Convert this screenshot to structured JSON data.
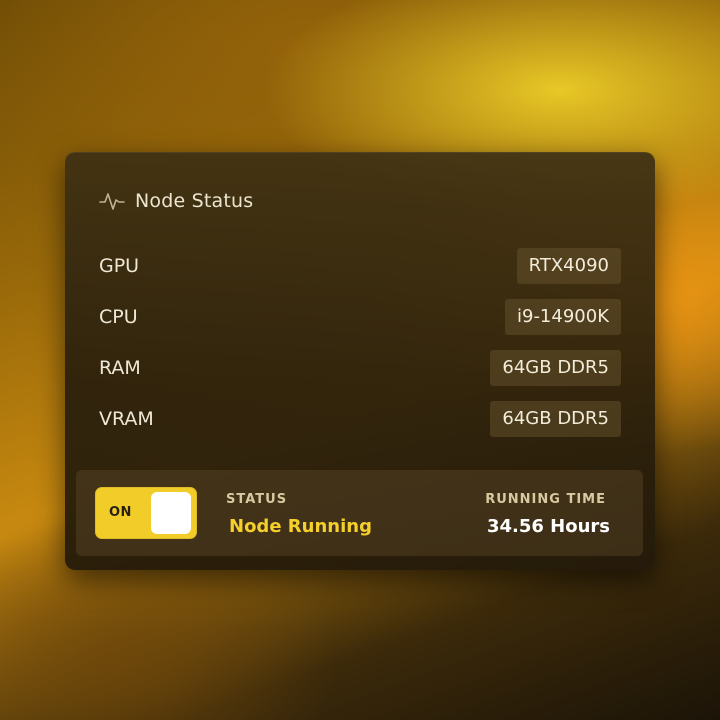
{
  "header": {
    "title": "Node Status",
    "icon": "pulse-icon"
  },
  "specs": [
    {
      "label": "GPU",
      "value": "RTX4090"
    },
    {
      "label": "CPU",
      "value": "i9-14900K"
    },
    {
      "label": "RAM",
      "value": "64GB DDR5"
    },
    {
      "label": "VRAM",
      "value": "64GB DDR5"
    }
  ],
  "status_panel": {
    "toggle_label": "ON",
    "toggle_state": "on",
    "status_label": "STATUS",
    "status_value": "Node Running",
    "runtime_label": "RUNNING TIME",
    "runtime_value": "34.56 Hours"
  },
  "colors": {
    "accent_yellow": "#f2cd2a",
    "status_text": "#f5cf2c",
    "card_bg": "#2e2410"
  }
}
